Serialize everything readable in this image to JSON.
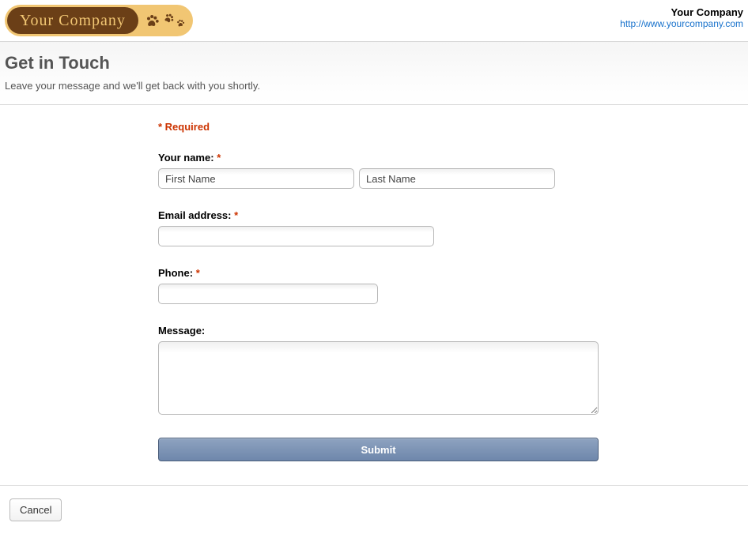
{
  "logo": {
    "text": "Your Company"
  },
  "company": {
    "name": "Your Company",
    "url": "http://www.yourcompany.com"
  },
  "header": {
    "title": "Get in Touch",
    "subtitle": "Leave your message and we'll get back with you shortly."
  },
  "form": {
    "required_note": "* Required",
    "name_label": "Your name:",
    "first_name_placeholder": "First Name",
    "last_name_placeholder": "Last Name",
    "email_label": "Email address:",
    "phone_label": "Phone:",
    "message_label": "Message:",
    "star": "*",
    "submit_label": "Submit"
  },
  "footer": {
    "cancel_label": "Cancel"
  }
}
